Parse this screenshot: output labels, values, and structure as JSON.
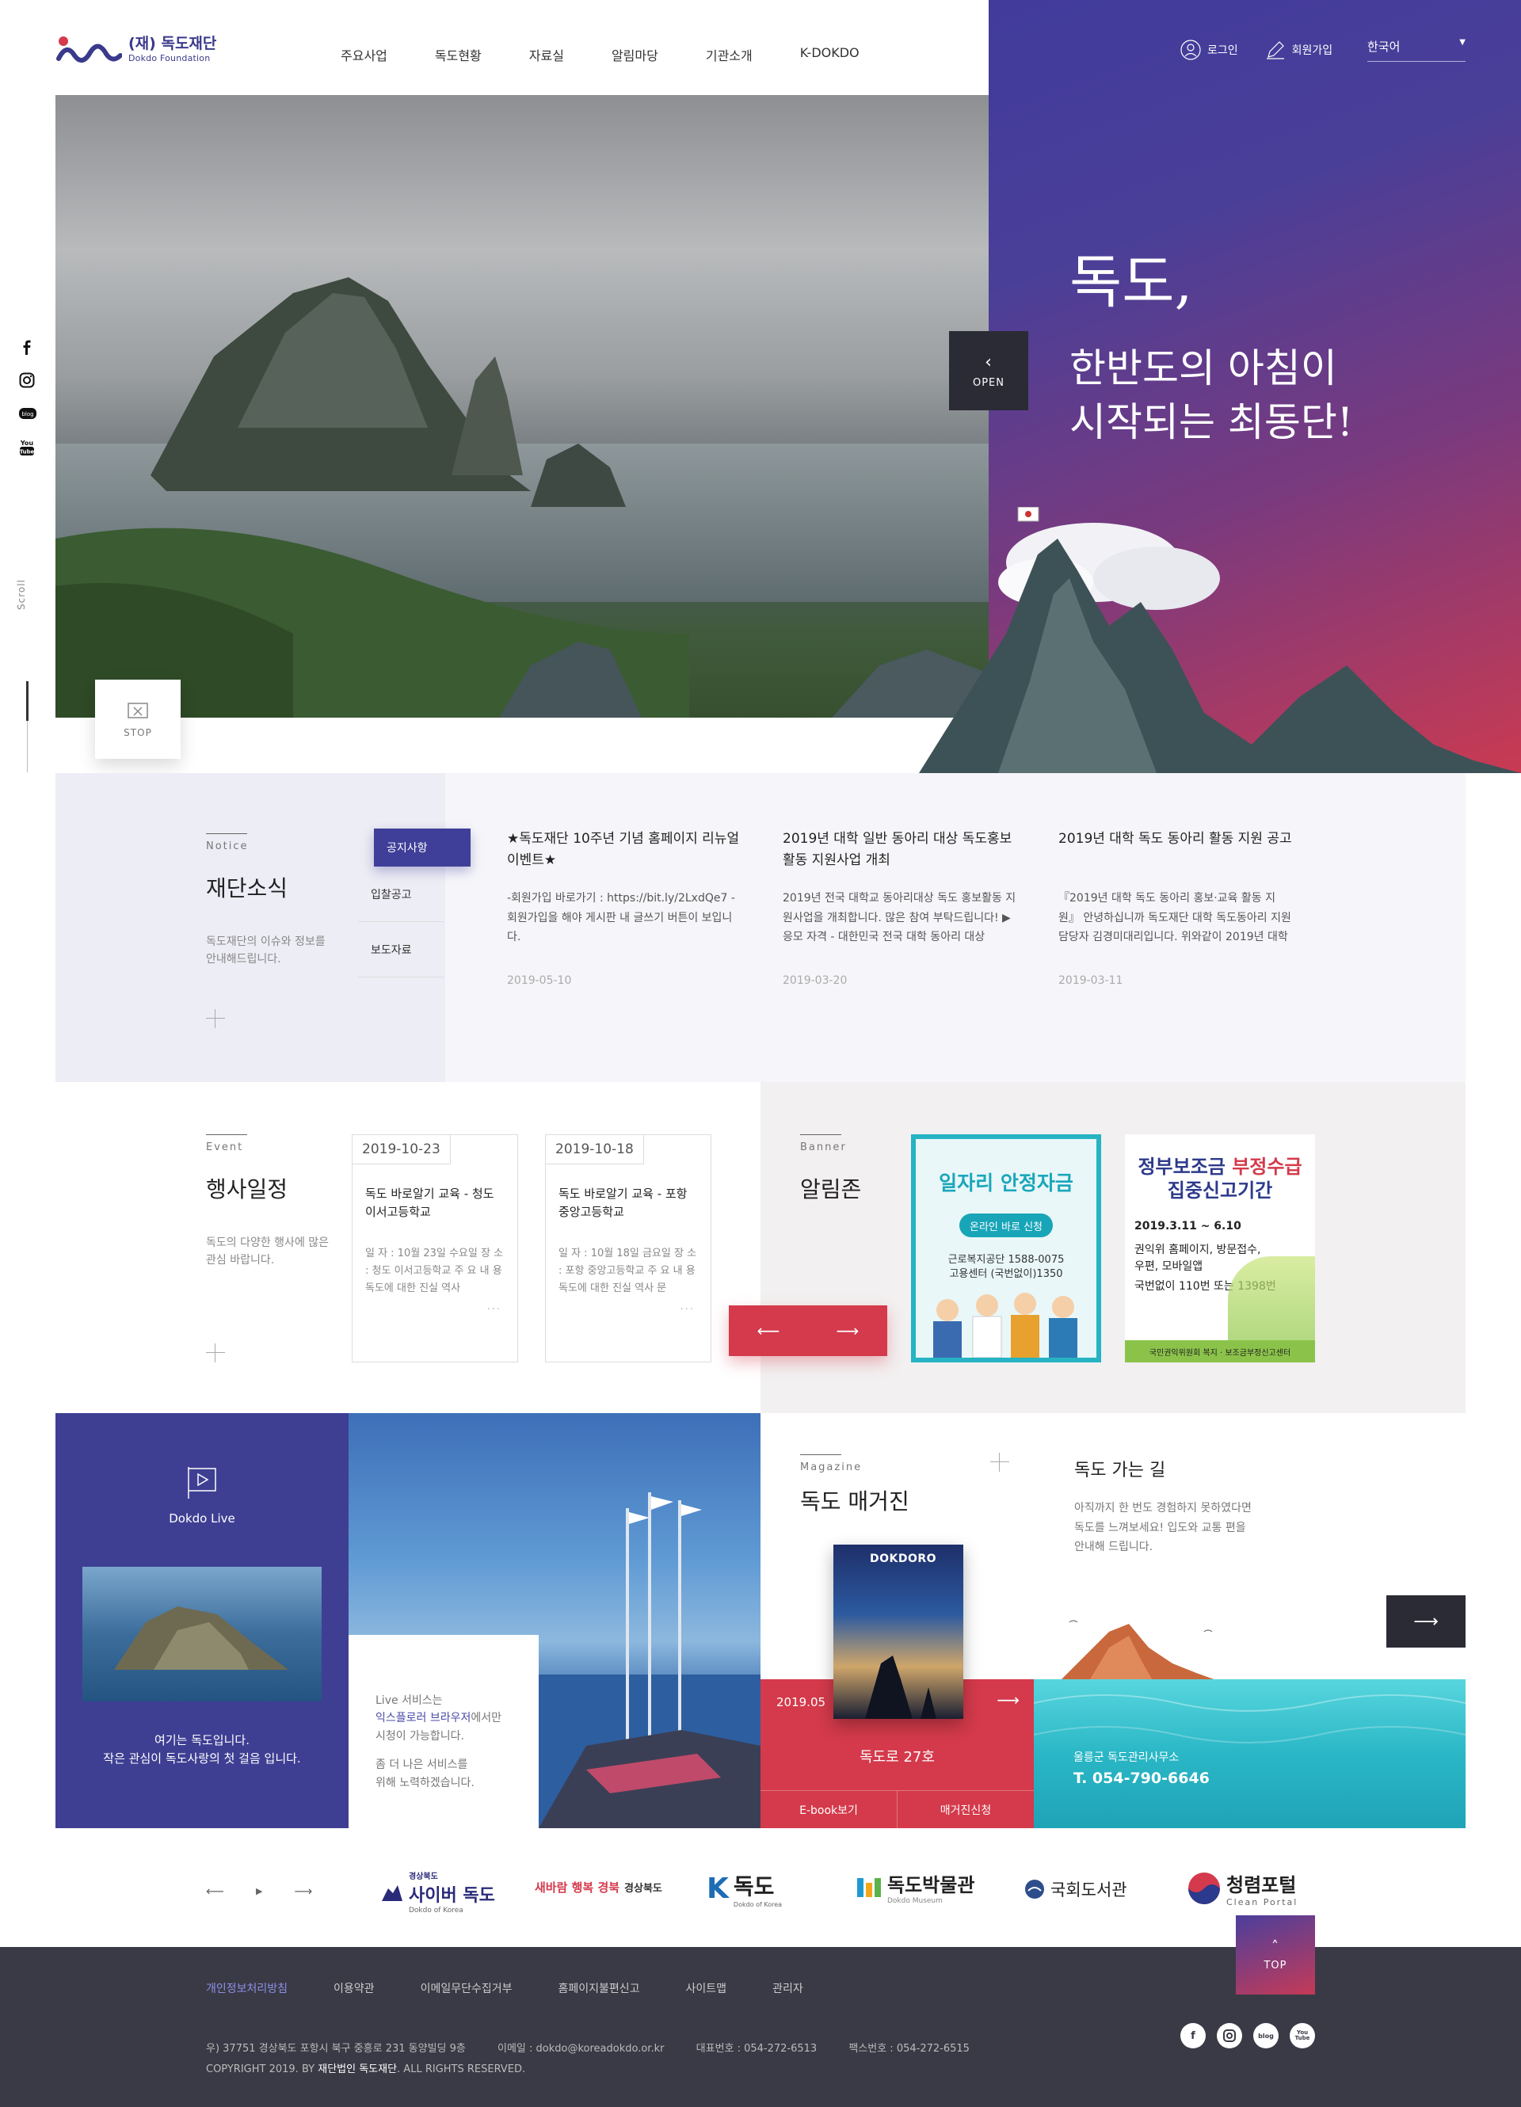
{
  "header": {
    "logo_ko": "(재) 독도재단",
    "logo_en": "Dokdo Foundation",
    "nav": [
      "주요사업",
      "독도현황",
      "자료실",
      "알림마당",
      "기관소개",
      "K-DOKDO"
    ],
    "login": "로그인",
    "signup": "회원가입",
    "lang": "한국어"
  },
  "hero": {
    "title": "독도,",
    "subtitle_1": "한반도의 아침이",
    "subtitle_2": "시작되는 최동단!",
    "open_label": "OPEN",
    "stop_label": "STOP",
    "scroll_label": "Scroll"
  },
  "side_sns": [
    "facebook-icon",
    "instagram-icon",
    "blog-icon",
    "youtube-icon"
  ],
  "side_sns_text": {
    "blog": "blog",
    "youtube": "You Tube"
  },
  "notice": {
    "label": "Notice",
    "title": "재단소식",
    "desc": "독도재단의 이슈와 정보를 안내해드립니다.",
    "tabs": [
      "공지사항",
      "입찰공고",
      "보도자료"
    ],
    "items": [
      {
        "title": "★독도재단 10주년 기념 홈페이지 리뉴얼 이벤트★",
        "text": "-회원가입 바로가기 : https://bit.ly/2LxdQe7 -회원가입을 해야 게시판 내 글쓰기 버튼이 보입니다.",
        "date": "2019-05-10"
      },
      {
        "title": "2019년 대학 일반 동아리 대상 독도홍보활동 지원사업 개최",
        "text": "2019년 전국 대학교 동아리대상 독도 홍보활동 지원사업을 개최합니다. 많은 참여 부탁드립니다! ▶ 응모 자격 - 대한민국 전국 대학 동아리 대상",
        "date": "2019-03-20"
      },
      {
        "title": "2019년 대학 독도 동아리 활동 지원 공고",
        "text": "『2019년 대학 독도 동아리 홍보·교육 활동 지원』 안녕하십니까 독도재단 대학 독도동아리 지원 담당자 김경미대리입니다. 위와같이 2019년 대학 독도",
        "date": "2019-03-11"
      }
    ]
  },
  "event": {
    "label": "Event",
    "title": "행사일정",
    "desc": "독도의 다양한 행사에 많은 관심 바랍니다.",
    "items": [
      {
        "date": "2019-10-23",
        "title": "독도 바로알기 교육 - 청도 이서고등학교",
        "text": "일 자 : 10월 23일 수요일 장 소 : 청도 이서고등학교 주 요 내 용 독도에 대한 진실 역사",
        "more": "···"
      },
      {
        "date": "2019-10-18",
        "title": "독도 바로알기 교육 - 포항 중앙고등학교",
        "text": "일 자 : 10월 18일 금요일 장 소 : 포항 중앙고등학교 주 요 내 용 독도에 대한 진실 역사 문",
        "more": "···"
      }
    ]
  },
  "banner": {
    "label": "Banner",
    "title": "알림존",
    "b1_title": "일자리 안정자금",
    "b1_btn": "온라인 바로 신청",
    "b1_line1": "근로복지공단 1588-0075",
    "b1_line2": "고용센터 (국번없이)1350",
    "b2_title_1a": "정부보조금 ",
    "b2_title_1b": "부정수급",
    "b2_title_2": "집중신고기간",
    "b2_date": "2019.3.11 ~ 6.10",
    "b2_line1": "권익위 홈페이지, 방문접수,",
    "b2_line2": "우편, 모바일앱",
    "b2_line3": "국번없이 110번 또는 1398번",
    "b2_footer": "국민권익위원회 복지 · 보조금부정신고센터"
  },
  "live": {
    "title": "Dokdo Live",
    "caption_1": "여기는 독도입니다.",
    "caption_2": "작은 관심이 독도사랑의 첫 걸음 입니다.",
    "note_1": "Live 서비스는",
    "note_2": "익스플로러 브라우저",
    "note_3": "에서만",
    "note_4": "시청이 가능합니다.",
    "note_5": "좀 더 나은 서비스를",
    "note_6": "위해 노력하겠습니다."
  },
  "magazine": {
    "label": "Magazine",
    "title": "독도 매거진",
    "cover_title": "DOKDORO",
    "issue_date": "2019.05",
    "issue_name": "독도로 27호",
    "btn_ebook": "E-book보기",
    "btn_apply": "매거진신청"
  },
  "route": {
    "title": "독도 가는 길",
    "desc_1": "아직까지 한 번도 경험하지 못하였다면",
    "desc_2": "독도를 느껴보세요! 입도와 교통 편을",
    "desc_3": "안내해 드립니다.",
    "office": "울릉군 독도관리사무소",
    "tel": "T. 054-790-6646"
  },
  "partners": {
    "logos": [
      {
        "name": "사이버 독도",
        "sub": "Dokdo of Korea",
        "small": "경상북도"
      },
      {
        "name": "새바람 행복 경북",
        "sub": "경상북도"
      },
      {
        "name": "독도",
        "sub": "Dokdo of Korea"
      },
      {
        "name": "독도박물관",
        "sub": "Dokdo Museum"
      },
      {
        "name": "국회도서관"
      },
      {
        "name": "청렴포털",
        "sub": "Clean Portal"
      }
    ]
  },
  "footer": {
    "links": [
      "개인정보처리방침",
      "이용약관",
      "이메일무단수집거부",
      "홈페이지불편신고",
      "사이트맵",
      "관리자"
    ],
    "address": "우) 37751 경상북도 포항시 북구 중흥로 231 동양빌딩 9층",
    "email": "이메일 : dokdo@koreadokdo.or.kr",
    "phone": "대표번호 : 054-272-6513",
    "fax": "팩스번호 : 054-272-6515",
    "copyright_1": "COPYRIGHT 2019. BY ",
    "copyright_2": "재단법인 독도재단",
    "copyright_3": ". ALL RIGHTS RESERVED.",
    "top_label": "TOP",
    "sns": [
      "facebook-icon",
      "instagram-icon",
      "blog-icon",
      "youtube-icon"
    ]
  },
  "colors": {
    "primary": "#3f3f99",
    "accent": "#d43a4b",
    "footer": "#3a3a46",
    "sea": "#2ab7c6"
  }
}
